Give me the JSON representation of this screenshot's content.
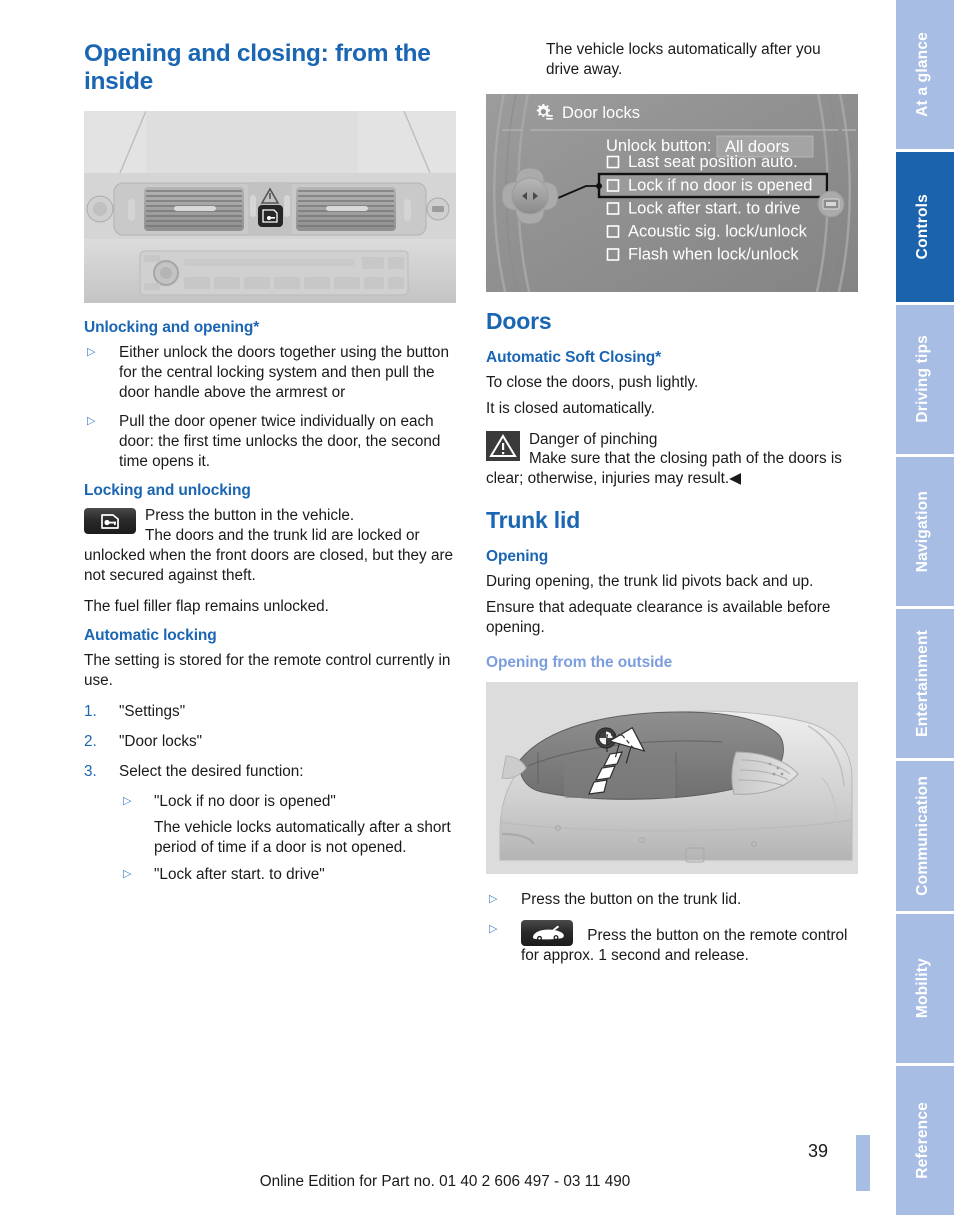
{
  "document": {
    "page_number": "39",
    "edition_line": "Online Edition for Part no. 01 40 2 606 497 - 03 11 490",
    "accent_blue": "#1a66b3",
    "tab_blue": "#a8bde3",
    "tab_active_blue": "#1c63ad",
    "subsub_blue": "#7c9ede"
  },
  "sidebar": {
    "tabs": [
      {
        "label": "At a glance",
        "active": false
      },
      {
        "label": "Controls",
        "active": true
      },
      {
        "label": "Driving tips",
        "active": false
      },
      {
        "label": "Navigation",
        "active": false
      },
      {
        "label": "Entertainment",
        "active": false
      },
      {
        "label": "Communication",
        "active": false
      },
      {
        "label": "Mobility",
        "active": false
      },
      {
        "label": "Reference",
        "active": false
      }
    ]
  },
  "left_column": {
    "chapter_title": "Opening and closing: from the inside",
    "figure_dashboard": {
      "name": "dashboard-center-console-photo",
      "caption": ""
    },
    "unlocking": {
      "heading": "Unlocking and opening*",
      "bullets": [
        "Either unlock the doors together using the button for the central locking system and then pull the door handle above the armrest or",
        "Pull the door opener twice individually on each door: the first time unlocks the door, the second time opens it."
      ]
    },
    "locking": {
      "heading": "Locking and unlocking",
      "badge_icon": "car-door-lock-icon",
      "line1": "Press the button in the vehicle.",
      "line2": "The doors and the trunk lid are locked or unlocked when the front doors are closed, but they are not secured against theft.",
      "line3": "The fuel filler flap remains unlocked."
    },
    "automatic_locking": {
      "heading": "Automatic locking",
      "intro": "The setting is stored for the remote control currently in use.",
      "steps": [
        {
          "num": "1.",
          "text": "\"Settings\""
        },
        {
          "num": "2.",
          "text": "\"Door locks\""
        },
        {
          "num": "3.",
          "text": "Select the desired function:"
        }
      ],
      "options": [
        {
          "label": "\"Lock if no door is opened\"",
          "description": "The vehicle locks automatically after a short period of time if a door is not opened."
        },
        {
          "label": "\"Lock after start. to drive\"",
          "description": ""
        }
      ]
    }
  },
  "right_column": {
    "intro_paragraph": "The vehicle locks automatically after you drive away.",
    "idrive_screen": {
      "name": "idrive-door-locks-menu",
      "title": "Door locks",
      "title_icon": "gear-settings-icon",
      "setting_label": "Unlock button:",
      "setting_value": "All doors",
      "items": [
        {
          "label": "Last seat position auto.",
          "checked": false,
          "highlighted": false
        },
        {
          "label": "Lock if no door is opened",
          "checked": false,
          "highlighted": true
        },
        {
          "label": "Lock after start. to drive",
          "checked": false,
          "highlighted": false
        },
        {
          "label": "Acoustic sig. lock/unlock",
          "checked": false,
          "highlighted": false
        },
        {
          "label": "Flash when lock/unlock",
          "checked": false,
          "highlighted": false
        }
      ],
      "controller_icon": "idrive-controller-left-right-icon",
      "side_icon": "display-icon"
    },
    "doors": {
      "heading": "Doors",
      "soft_closing": {
        "heading": "Automatic Soft Closing*",
        "line1": "To close the doors, push lightly.",
        "line2": "It is closed automatically.",
        "warning_icon": "warning-triangle-icon",
        "warning_title": "Danger of pinching",
        "warning_body": "Make sure that the closing path of the doors is clear; otherwise, injuries may result.◀"
      }
    },
    "trunk": {
      "heading": "Trunk lid",
      "opening": {
        "heading": "Opening",
        "line1": "During opening, the trunk lid pivots back and up.",
        "line2": "Ensure that adequate clearance is available before opening."
      },
      "outside": {
        "heading": "Opening from the outside",
        "figure": {
          "name": "trunk-lid-rear-view-illustration"
        },
        "bullets": [
          {
            "badge": "",
            "text": "Press the button on the trunk lid."
          },
          {
            "badge": "remote-trunk-icon",
            "text": "Press the button on the remote control for approx. 1 second and release."
          }
        ]
      }
    }
  }
}
